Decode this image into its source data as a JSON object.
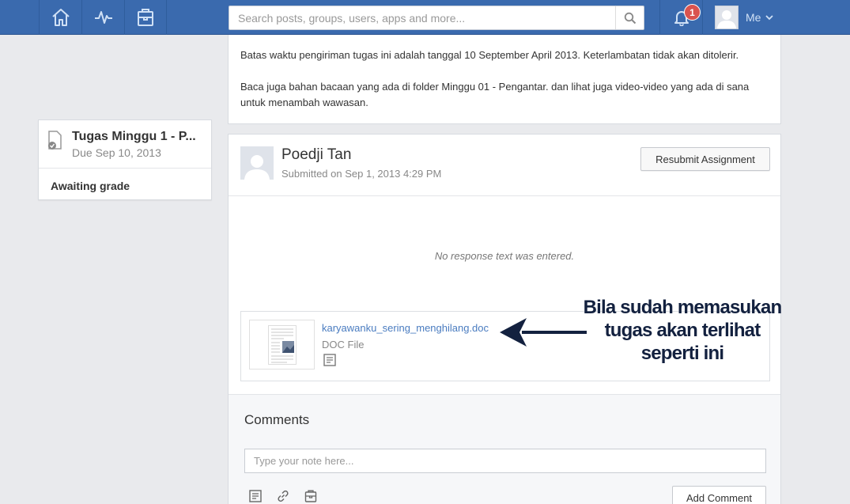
{
  "colors": {
    "topbar": "#3a6aae",
    "link": "#4a7cc0",
    "badge": "#d9534f",
    "annotation": "#13213f"
  },
  "topbar": {
    "nav_icons": [
      "home-icon",
      "activity-icon",
      "backpack-icon"
    ],
    "search_placeholder": "Search posts, groups, users, apps and more...",
    "notification_count": "1",
    "user_label": "Me"
  },
  "assignment": {
    "title": "Tugas Minggu 1 - P...",
    "due": "Due Sep 10, 2013",
    "status": "Awaiting grade"
  },
  "instructions": {
    "paragraph1": "Batas waktu pengiriman tugas ini adalah tanggal 10 September April 2013. Keterlambatan tidak akan ditolerir.",
    "paragraph2": "Baca juga bahan bacaan yang ada di folder Minggu 01 - Pengantar. dan lihat juga video-video yang ada di sana untuk menambah wawasan."
  },
  "submission": {
    "user_name": "Poedji Tan",
    "submitted_on": "Submitted on Sep 1, 2013 4:29 PM",
    "resubmit_label": "Resubmit Assignment",
    "no_response": "No response text was entered.",
    "attachment_name": "karyawanku_sering_menghilang.doc",
    "attachment_type": "DOC File"
  },
  "comments": {
    "title": "Comments",
    "placeholder": "Type your note here...",
    "add_label": "Add Comment",
    "tool_icons": [
      "note-icon",
      "link-icon",
      "backpack-icon"
    ]
  },
  "annotation": {
    "line1": "Bila sudah memasukan",
    "line2": "tugas akan terlihat",
    "line3": "seperti ini"
  }
}
